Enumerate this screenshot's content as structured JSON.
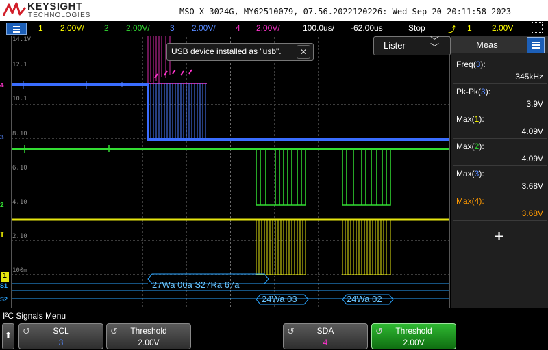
{
  "brand": {
    "name": "KEYSIGHT",
    "sub": "TECHNOLOGIES"
  },
  "title": "MSO-X 3024G, MY62510079, 07.56.2022120226: Wed Sep 20 20:11:58 2023",
  "colors": {
    "ch1": "#ffff00",
    "ch2": "#33dd33",
    "ch3": "#3377ff",
    "ch4": "#ff33cc",
    "bus": "#2aa5ff",
    "accent": "#1c5fb8",
    "meas4": "#ff9900",
    "green_key": "#1e9e20"
  },
  "channels": [
    {
      "num": "1",
      "scale": "2.00V/"
    },
    {
      "num": "2",
      "scale": "2.00V/"
    },
    {
      "num": "3",
      "scale": "2.00V/"
    },
    {
      "num": "4",
      "scale": "2.00V/"
    }
  ],
  "timebase": "100.0us/",
  "delay": "-62.00us",
  "run_state": "Stop",
  "trigger": {
    "source": "1",
    "level": "2.00V"
  },
  "scale_labels": [
    "14.1V",
    "12.1",
    "10.1",
    "8.10",
    "6.10",
    "4.10",
    "2.10",
    "100m"
  ],
  "channel_markers": {
    "m4": "4",
    "m3": "3",
    "m2": "2",
    "m1": "1",
    "trig": "T",
    "bus_s1": "S1",
    "bus_s2": "S2"
  },
  "toast": {
    "text": "USB device installed as \"usb\".",
    "close": "✕"
  },
  "lister": {
    "label": "Lister"
  },
  "decode": {
    "s1": [
      {
        "text": "27Wa 00a S27Ra 67a"
      }
    ],
    "s2": [
      {
        "text": "24Wa 03"
      },
      {
        "text": "24Wa 02"
      }
    ]
  },
  "meas_panel": {
    "title": "Meas",
    "items": [
      {
        "label": "Freq",
        "src": "3",
        "value": "345kHz"
      },
      {
        "label": "Pk-Pk",
        "src": "3",
        "value": "3.9V"
      },
      {
        "label": "Max",
        "src": "1",
        "value": "4.09V"
      },
      {
        "label": "Max",
        "src": "2",
        "value": "4.09V"
      },
      {
        "label": "Max",
        "src": "3",
        "value": "3.68V"
      },
      {
        "label": "Max",
        "src": "4",
        "value": "3.68V"
      }
    ],
    "add": "+"
  },
  "menu_title": "I²C Signals Menu",
  "softkeys": [
    {
      "title": "SCL",
      "value": "3"
    },
    {
      "title": "Threshold",
      "value": "2.00V"
    },
    {
      "title": "SDA",
      "value": "4"
    },
    {
      "title": "Threshold",
      "value": "2.00V"
    }
  ]
}
